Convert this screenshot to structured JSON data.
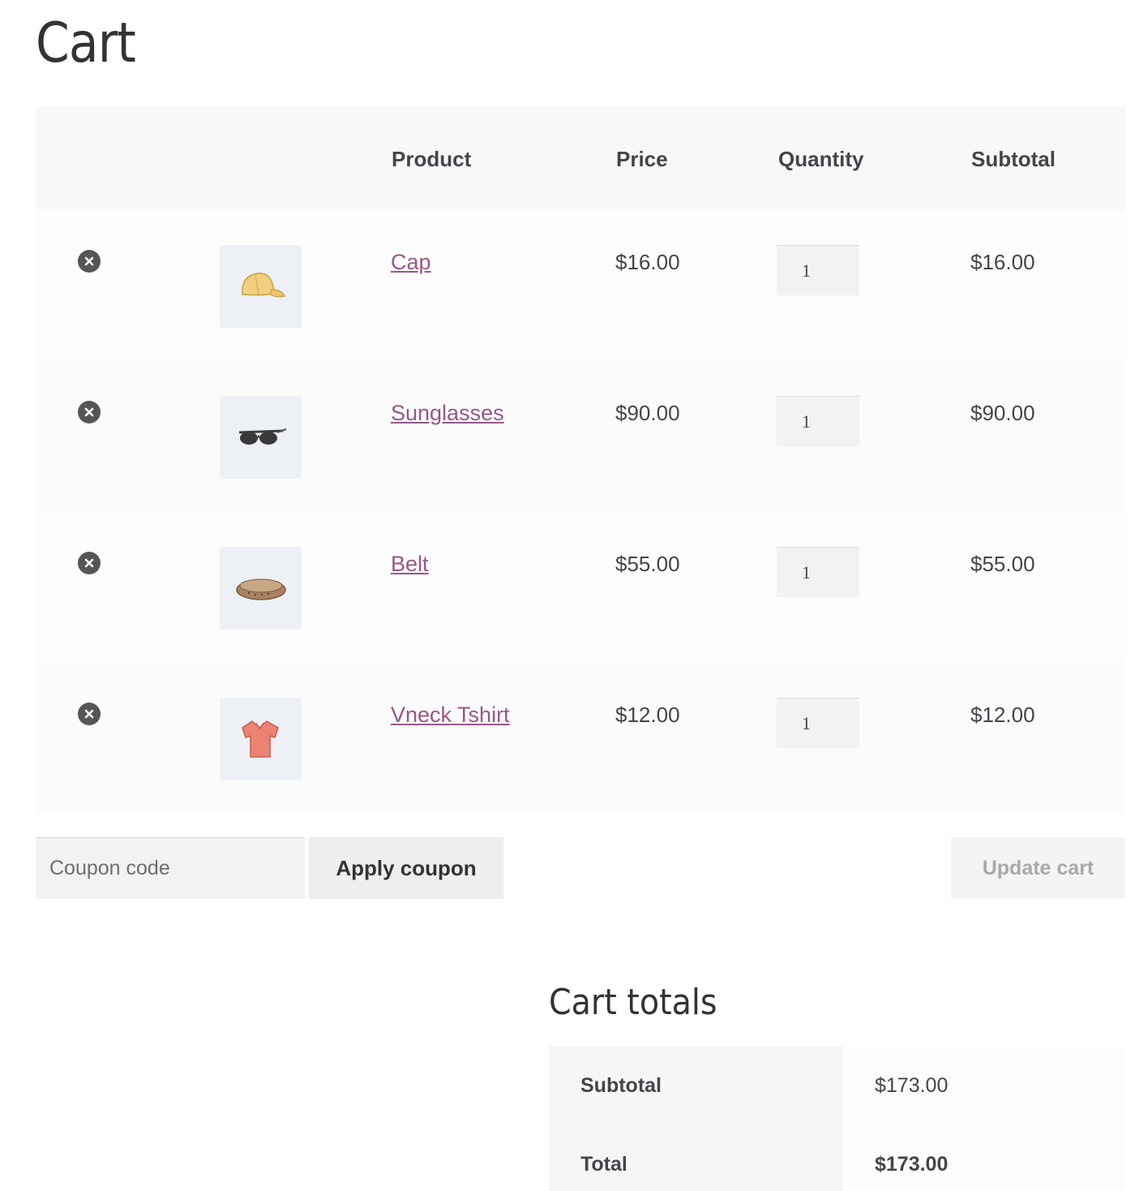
{
  "page": {
    "title": "Cart"
  },
  "table": {
    "headers": {
      "product": "Product",
      "price": "Price",
      "quantity": "Quantity",
      "subtotal": "Subtotal"
    },
    "items": [
      {
        "name": "Cap",
        "price": "$16.00",
        "quantity": "1",
        "subtotal": "$16.00",
        "icon": "cap-icon"
      },
      {
        "name": "Sunglasses",
        "price": "$90.00",
        "quantity": "1",
        "subtotal": "$90.00",
        "icon": "sunglasses-icon"
      },
      {
        "name": "Belt",
        "price": "$55.00",
        "quantity": "1",
        "subtotal": "$55.00",
        "icon": "belt-icon"
      },
      {
        "name": "Vneck Tshirt",
        "price": "$12.00",
        "quantity": "1",
        "subtotal": "$12.00",
        "icon": "tshirt-icon"
      }
    ]
  },
  "actions": {
    "coupon_placeholder": "Coupon code",
    "apply_coupon": "Apply coupon",
    "update_cart": "Update cart"
  },
  "totals": {
    "title": "Cart totals",
    "subtotal_label": "Subtotal",
    "subtotal_value": "$173.00",
    "total_label": "Total",
    "total_value": "$173.00"
  },
  "colors": {
    "link": "#96588a",
    "text": "#43454b",
    "remove_icon": "#555555"
  }
}
